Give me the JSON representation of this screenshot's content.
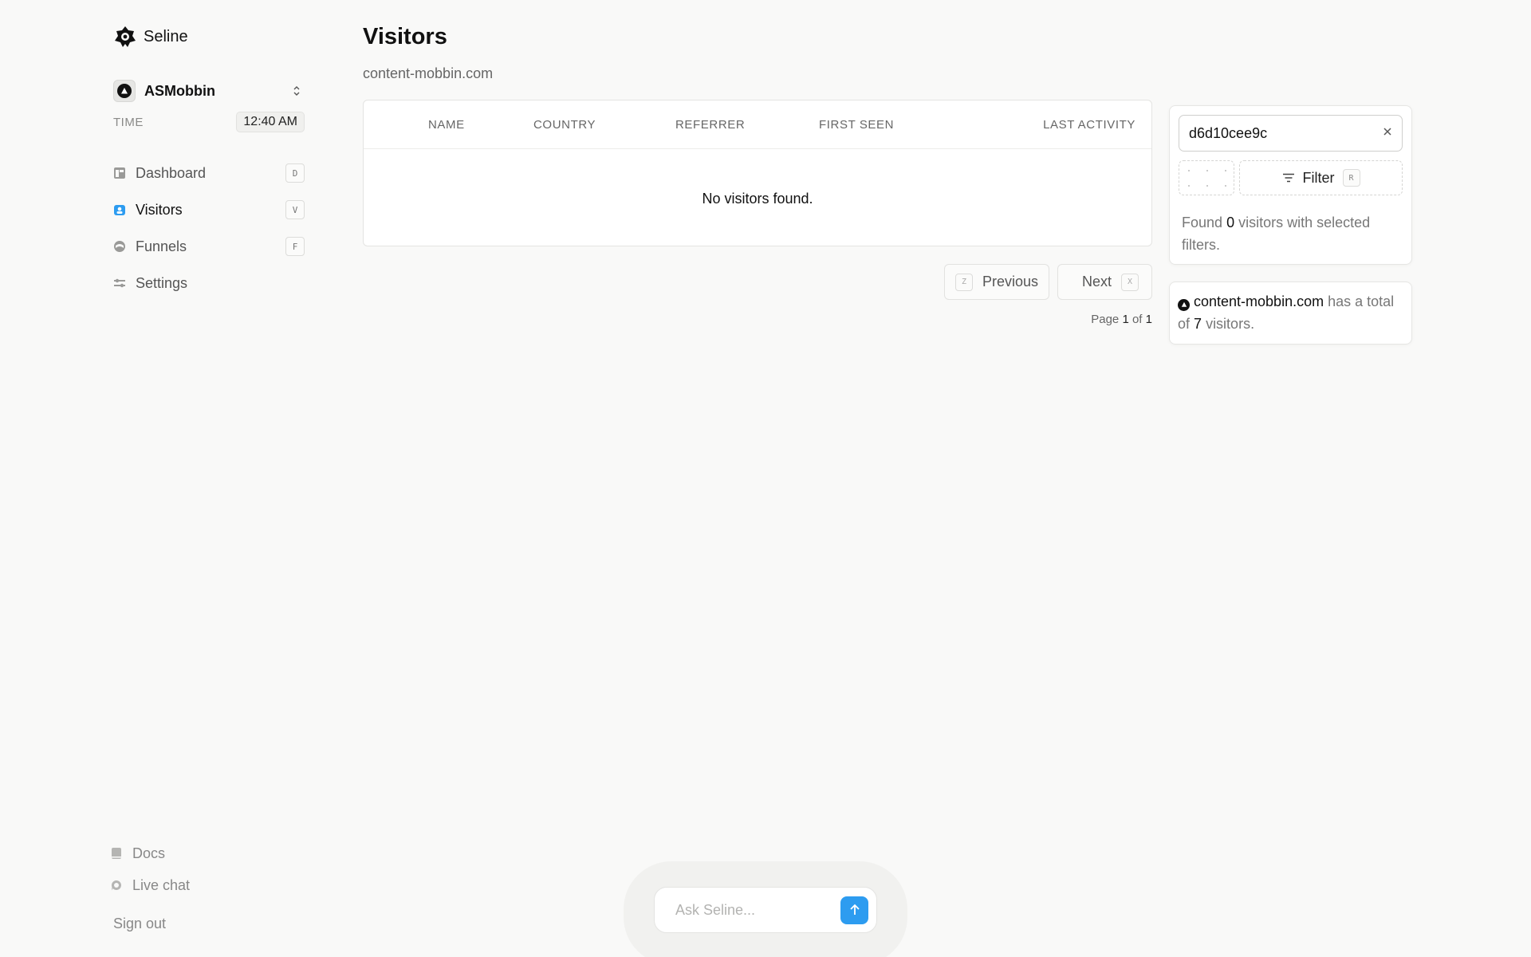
{
  "app": {
    "name": "Seline"
  },
  "workspace": {
    "name": "ASMobbin"
  },
  "time": {
    "label": "TIME",
    "value": "12:40 AM"
  },
  "nav": {
    "items": [
      {
        "label": "Dashboard",
        "icon": "dashboard-icon",
        "key": "D",
        "active": false
      },
      {
        "label": "Visitors",
        "icon": "visitors-icon",
        "key": "V",
        "active": true
      },
      {
        "label": "Funnels",
        "icon": "funnels-icon",
        "key": "F",
        "active": false
      },
      {
        "label": "Settings",
        "icon": "settings-icon",
        "key": "",
        "active": false
      }
    ]
  },
  "footer": {
    "docs": "Docs",
    "live_chat": "Live chat",
    "sign_out": "Sign out"
  },
  "page": {
    "title": "Visitors",
    "subtitle": "content-mobbin.com"
  },
  "table": {
    "columns": [
      "NAME",
      "COUNTRY",
      "REFERRER",
      "FIRST SEEN",
      "LAST ACTIVITY"
    ],
    "rows": [],
    "empty_message": "No visitors found."
  },
  "pagination": {
    "previous_label": "Previous",
    "previous_key": "Z",
    "next_label": "Next",
    "next_key": "X",
    "page_prefix": "Page",
    "current": "1",
    "of": "of",
    "total": "1"
  },
  "search": {
    "value": "d6d10cee9c"
  },
  "filter": {
    "label": "Filter",
    "key": "R",
    "found_prefix": "Found",
    "found_count": "0",
    "found_suffix": "visitors with selected filters."
  },
  "summary": {
    "site": "content-mobbin.com",
    "text_1": "has a total of",
    "count": "7",
    "text_2": "visitors."
  },
  "ask": {
    "placeholder": "Ask Seline..."
  },
  "colors": {
    "accent": "#2d9cf0",
    "background": "#f9f9f8"
  }
}
